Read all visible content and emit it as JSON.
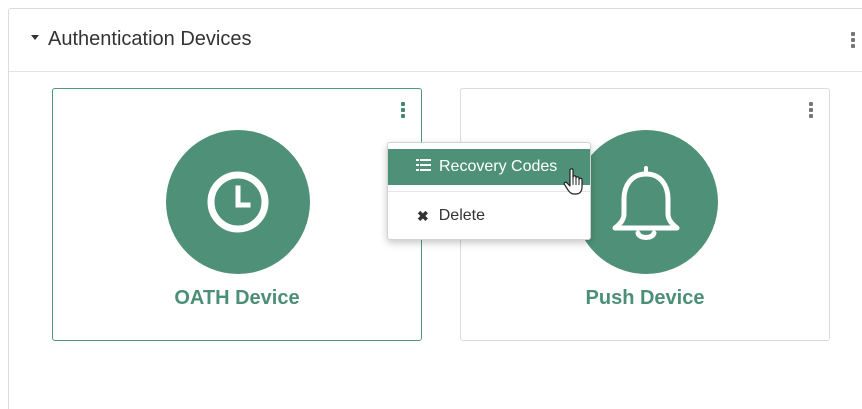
{
  "panel": {
    "title": "Authentication Devices"
  },
  "devices": [
    {
      "label": "OATH Device",
      "icon": "clock-icon",
      "selected": true
    },
    {
      "label": "Push Device",
      "icon": "bell-icon",
      "selected": false
    }
  ],
  "context_menu": {
    "items": [
      {
        "label": "Recovery Codes",
        "icon": "list-icon",
        "active": true
      },
      {
        "label": "Delete",
        "icon": "close-icon",
        "active": false
      }
    ]
  },
  "colors": {
    "accent": "#4f9178",
    "accent_text": "#4b8f76",
    "border": "#dcdcdc"
  }
}
